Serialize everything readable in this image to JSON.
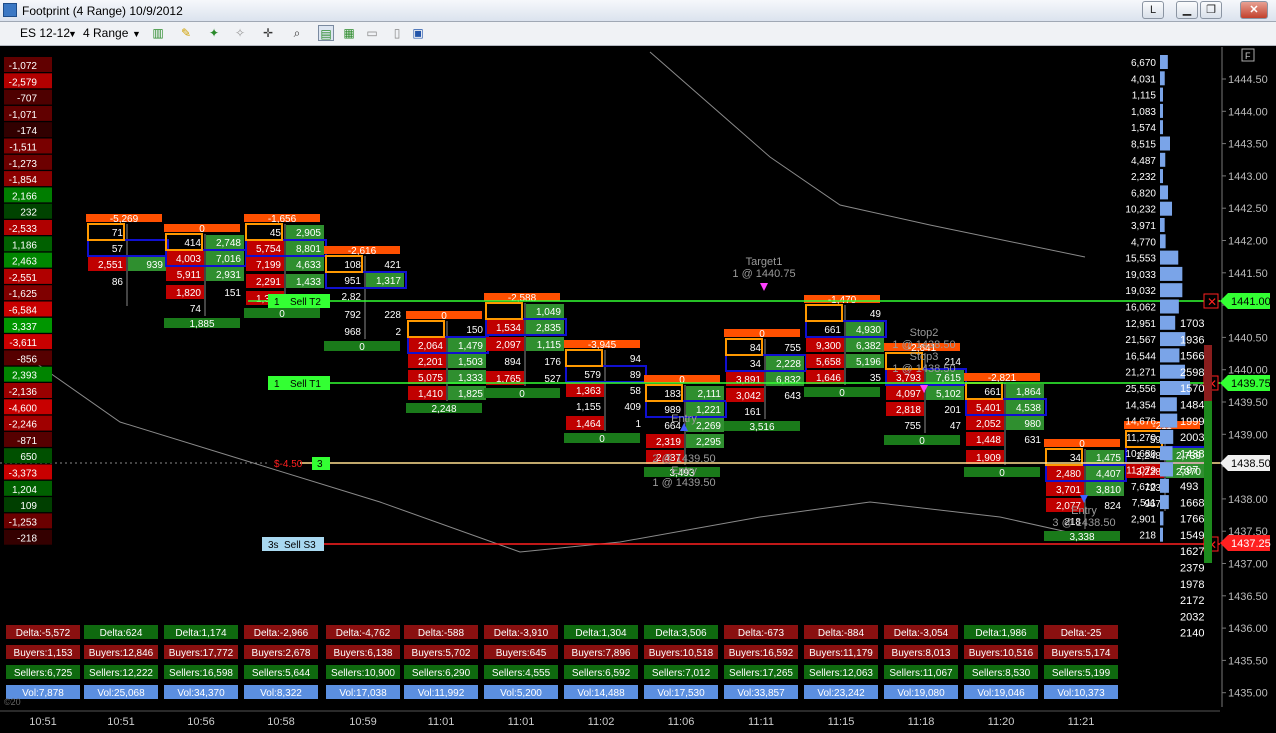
{
  "window": {
    "title": "Footprint (4 Range)  10/9/2012",
    "btn_l": "L",
    "btn_min": "▁",
    "btn_max": "❐",
    "btn_close": "✕"
  },
  "toolbar": {
    "instrument": "ES 12-12",
    "period": "4 Range"
  },
  "colors": {
    "up": "#2f8f2f",
    "down": "#c00000",
    "orange": "#ff5000",
    "blue": "#1010d0",
    "amber": "#ff9900",
    "lime": "#33ff33",
    "stop": "#ff2020",
    "price": "#cccccc"
  },
  "price_axis": {
    "labels": [
      "1444.50",
      "1444.00",
      "1443.50",
      "1443.00",
      "1442.50",
      "1442.00",
      "1441.50",
      "1441.00",
      "1440.50",
      "1440.00",
      "1439.50",
      "1439.00",
      "1438.50",
      "1438.00",
      "1437.50",
      "1437.00",
      "1436.50",
      "1436.00",
      "1435.50",
      "1435.00"
    ],
    "marker_top": "1441.00",
    "marker_mid": "1439.75",
    "marker_last": "1438.50",
    "marker_bottom": "1437.25"
  },
  "time_axis": [
    "10:51",
    "10:51",
    "10:56",
    "10:58",
    "10:59",
    "11:01",
    "11:01",
    "11:02",
    "11:06",
    "11:11",
    "11:15",
    "11:18",
    "11:20",
    "11:21"
  ],
  "left_delta": [
    "-1,072",
    "-2,579",
    "-707",
    "-1,071",
    "-174",
    "-1,511",
    "-1,273",
    "-1,854",
    "2,166",
    "232",
    "-2,533",
    "1,186",
    "2,463",
    "-2,551",
    "-1,625",
    "-6,584",
    "3,337",
    "-3,611",
    "-856",
    "2,393",
    "-2,136",
    "-4,600",
    "-2,246",
    "-871",
    "650",
    "-3,373",
    "1,204",
    "109",
    "-1,253",
    "-218"
  ],
  "right_volume": [
    "6,670",
    "4,031",
    "1,115",
    "1,083",
    "1,574",
    "8,515",
    "4,487",
    "2,232",
    "6,820",
    "10,232",
    "3,971",
    "4,770",
    "15,553",
    "19,033",
    "19,032",
    "16,062",
    "12,951",
    "21,567",
    "16,544",
    "21,271",
    "25,556",
    "14,354",
    "14,676",
    "11,270",
    "10,680",
    "11,079",
    "7,610",
    "7,511",
    "2,901",
    "218"
  ],
  "right_numbers": [
    "1703",
    "1936",
    "1566",
    "2598",
    "1570",
    "1484",
    "1999",
    "2003",
    "1438",
    "597",
    "493",
    "1668",
    "1766",
    "1549",
    "1627",
    "2379",
    "1978",
    "2172",
    "2032",
    "2140"
  ],
  "stats": {
    "delta": [
      "Delta:-5,572",
      "Delta:624",
      "Delta:1,174",
      "Delta:-2,966",
      "Delta:-4,762",
      "Delta:-588",
      "Delta:-3,910",
      "Delta:1,304",
      "Delta:3,506",
      "Delta:-673",
      "Delta:-884",
      "Delta:-3,054",
      "Delta:1,986",
      "Delta:-25"
    ],
    "buyers": [
      "Buyers:1,153",
      "Buyers:12,846",
      "Buyers:17,772",
      "Buyers:2,678",
      "Buyers:6,138",
      "Buyers:5,702",
      "Buyers:645",
      "Buyers:7,896",
      "Buyers:10,518",
      "Buyers:16,592",
      "Buyers:11,179",
      "Buyers:8,013",
      "Buyers:10,516",
      "Buyers:5,174"
    ],
    "sellers": [
      "Sellers:6,725",
      "Sellers:12,222",
      "Sellers:16,598",
      "Sellers:5,644",
      "Sellers:10,900",
      "Sellers:6,290",
      "Sellers:4,555",
      "Sellers:6,592",
      "Sellers:7,012",
      "Sellers:17,265",
      "Sellers:12,063",
      "Sellers:11,067",
      "Sellers:8,530",
      "Sellers:5,199"
    ],
    "vol": [
      "Vol:7,878",
      "Vol:25,068",
      "Vol:34,370",
      "Vol:8,322",
      "Vol:17,038",
      "Vol:11,992",
      "Vol:5,200",
      "Vol:14,488",
      "Vol:17,530",
      "Vol:33,857",
      "Vol:23,242",
      "Vol:19,080",
      "Vol:19,046",
      "Vol:10,373"
    ]
  },
  "orders": {
    "sell_t2": {
      "qty": "1",
      "label": "Sell T2"
    },
    "sell_t1": {
      "qty": "1",
      "label": "Sell T1"
    },
    "sell_s3": {
      "qty": "3s",
      "label": "Sell S3"
    },
    "pnl": "$-4.50",
    "pos_qty": "3"
  },
  "annotations": {
    "target1": "Target1",
    "target1_fill": "1 @ 1440.75",
    "stop2": "Stop2",
    "stop2_fill": "1 @ 1438.50",
    "stop3": "Stop3",
    "stop3_fill": "1 @ 1438.50",
    "entry_a": "Entry",
    "entry_a_fill": "2 @ 1439.50",
    "entry_b": "Entry",
    "entry_b_fill": "1 @ 1439.50",
    "entry_c": "Entry",
    "entry_c_fill": "3 @ 1438.50",
    "footer_mark": "©20"
  },
  "bars": [
    {
      "top": "-5,269",
      "bot": "",
      "cells": [
        [
          "71",
          ""
        ],
        [
          "57",
          ""
        ],
        [
          "2,551",
          "939"
        ],
        [
          "86",
          ""
        ],
        [
          "",
          ""
        ]
      ]
    },
    {
      "top": "0",
      "bot": "1,885",
      "cells": [
        [
          "414",
          "2,748"
        ],
        [
          "4,003",
          "7,016"
        ],
        [
          "5,911",
          "2,931"
        ],
        [
          "1,820",
          "151"
        ],
        [
          "74",
          ""
        ]
      ]
    },
    {
      "top": "-1,656",
      "bot": "0",
      "cells": [
        [
          "45",
          "2,905"
        ],
        [
          "5,754",
          "8,801"
        ],
        [
          "7,199",
          "4,633"
        ],
        [
          "2,291",
          "1,433"
        ],
        [
          "1,309",
          ""
        ]
      ]
    },
    {
      "top": "-2,616",
      "bot": "0",
      "cells": [
        [
          "108",
          "421"
        ],
        [
          "951",
          "1,317"
        ],
        [
          "2,82",
          ""
        ],
        [
          "792",
          "228"
        ],
        [
          "968",
          "2"
        ]
      ]
    },
    {
      "top": "0",
      "bot": "2,248",
      "cells": [
        [
          "",
          "150"
        ],
        [
          "2,064",
          "1,479"
        ],
        [
          "2,201",
          "1,503"
        ],
        [
          "5,075",
          "1,333"
        ],
        [
          "1,410",
          "1,825"
        ]
      ]
    },
    {
      "top": "-2,588",
      "bot": "0",
      "cells": [
        [
          "",
          "1,049"
        ],
        [
          "1,534",
          "2,835"
        ],
        [
          "2,097",
          "1,115"
        ],
        [
          "894",
          "176"
        ],
        [
          "1,765",
          "527"
        ]
      ]
    },
    {
      "top": "-3,945",
      "bot": "0",
      "cells": [
        [
          "",
          "94"
        ],
        [
          "579",
          "89"
        ],
        [
          "1,363",
          "58"
        ],
        [
          "1,155",
          "409"
        ],
        [
          "1,464",
          "1"
        ]
      ]
    },
    {
      "top": "0",
      "bot": "3,493",
      "cells": [
        [
          "183",
          "2,111"
        ],
        [
          "989",
          "1,221"
        ],
        [
          "664",
          "2,269"
        ],
        [
          "2,319",
          "2,295"
        ],
        [
          "2,437",
          ""
        ]
      ]
    },
    {
      "top": "0",
      "bot": "3,516",
      "cells": [
        [
          "84",
          "755"
        ],
        [
          "34",
          "2,228"
        ],
        [
          "3,891",
          "6,832"
        ],
        [
          "3,042",
          "643"
        ],
        [
          "161",
          ""
        ]
      ]
    },
    {
      "top": "-1,470",
      "bot": "0",
      "cells": [
        [
          "",
          "49"
        ],
        [
          "661",
          "4,930"
        ],
        [
          "9,300",
          "6,382"
        ],
        [
          "5,658",
          "5,196"
        ],
        [
          "1,646",
          "35"
        ]
      ]
    },
    {
      "top": "-2,641",
      "bot": "0",
      "cells": [
        [
          "",
          "214"
        ],
        [
          "3,793",
          "7,615"
        ],
        [
          "4,097",
          "5,102"
        ],
        [
          "2,818",
          "201"
        ],
        [
          "755",
          "47"
        ]
      ]
    },
    {
      "top": "-2,821",
      "bot": "0",
      "cells": [
        [
          "661",
          "1,864"
        ],
        [
          "5,401",
          "4,538"
        ],
        [
          "2,052",
          "980"
        ],
        [
          "1,448",
          "631"
        ],
        [
          "1,909",
          ""
        ]
      ]
    },
    {
      "top": "0",
      "bot": "3,338",
      "cells": [
        [
          "34",
          "1,475"
        ],
        [
          "2,480",
          "4,407"
        ],
        [
          "3,701",
          "3,810"
        ],
        [
          "2,077",
          "824"
        ],
        [
          "218",
          ""
        ]
      ]
    },
    {
      "top": "-211",
      "bot": "",
      "cells": [
        [
          "59",
          ""
        ],
        [
          "1,248",
          "2,739"
        ],
        [
          "3,228",
          "2,370"
        ],
        [
          "723",
          ""
        ],
        [
          "967",
          ""
        ]
      ]
    }
  ]
}
